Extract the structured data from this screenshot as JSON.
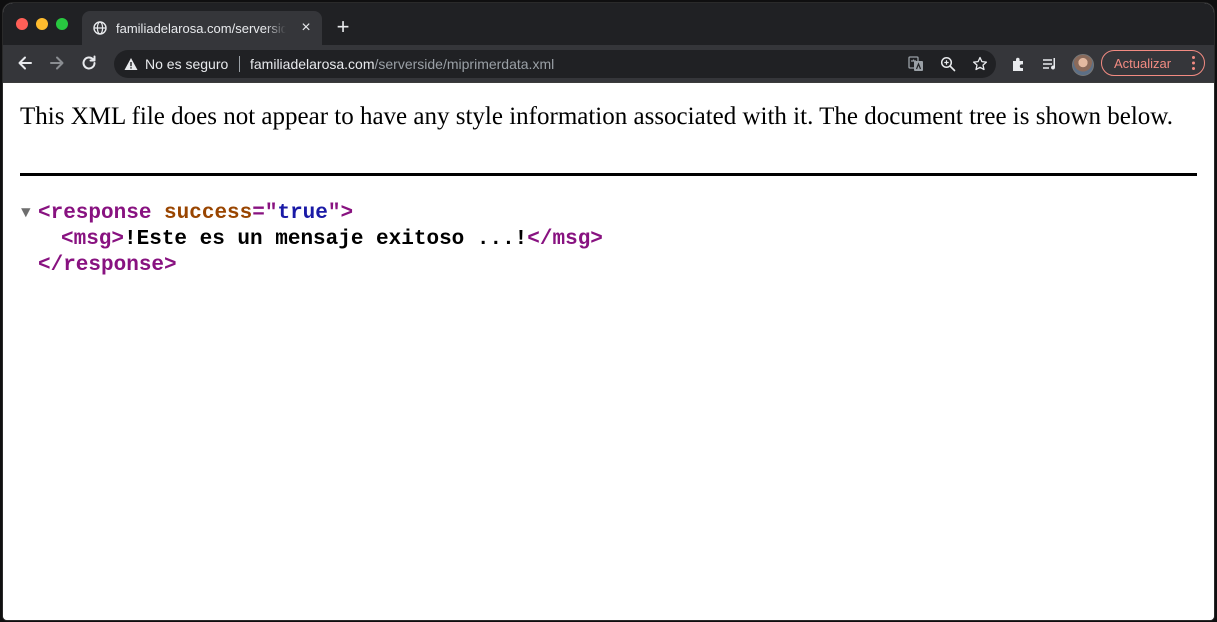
{
  "browser": {
    "tab": {
      "title": "familiadelarosa.com/serverside/miprimerdata.xml",
      "favicon": "globe-icon"
    },
    "omnibox": {
      "security_label": "No es seguro",
      "url_host": "familiadelarosa.com",
      "url_path": "/serverside/miprimerdata.xml"
    },
    "update_button_label": "Actualizar",
    "colors": {
      "tabstrip": "#202124",
      "toolbar": "#35363a",
      "accent": "#f28b82"
    }
  },
  "xml_viewer": {
    "info_message": "This XML file does not appear to have any style information associated with it. The document tree is shown below.",
    "tree": {
      "root_open": "<response",
      "attr_name": "success",
      "attr_eq": "=\"",
      "attr_value": "true",
      "attr_close": "\">",
      "child_open": "<msg>",
      "child_text": "!Este es un mensaje exitoso ...!",
      "child_close": "</msg>",
      "root_close": "</response>"
    },
    "colors": {
      "tag": "#881280",
      "attribute": "#994500",
      "value": "#1a1aa6"
    }
  }
}
